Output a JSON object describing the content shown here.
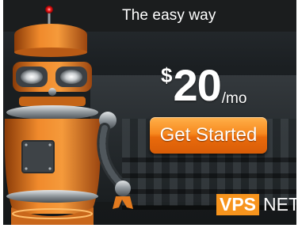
{
  "ad": {
    "tagline": "The easy way",
    "price": {
      "currency": "$",
      "amount": "20",
      "period": "/mo"
    },
    "cta_label": "Get Started",
    "logo": {
      "primary": "VPS",
      "secondary": "NET"
    },
    "illustration": "robot-illustration"
  },
  "colors": {
    "accent_orange": "#f7891f",
    "background_dark": "#1b1f22",
    "text_white": "#ffffff"
  }
}
